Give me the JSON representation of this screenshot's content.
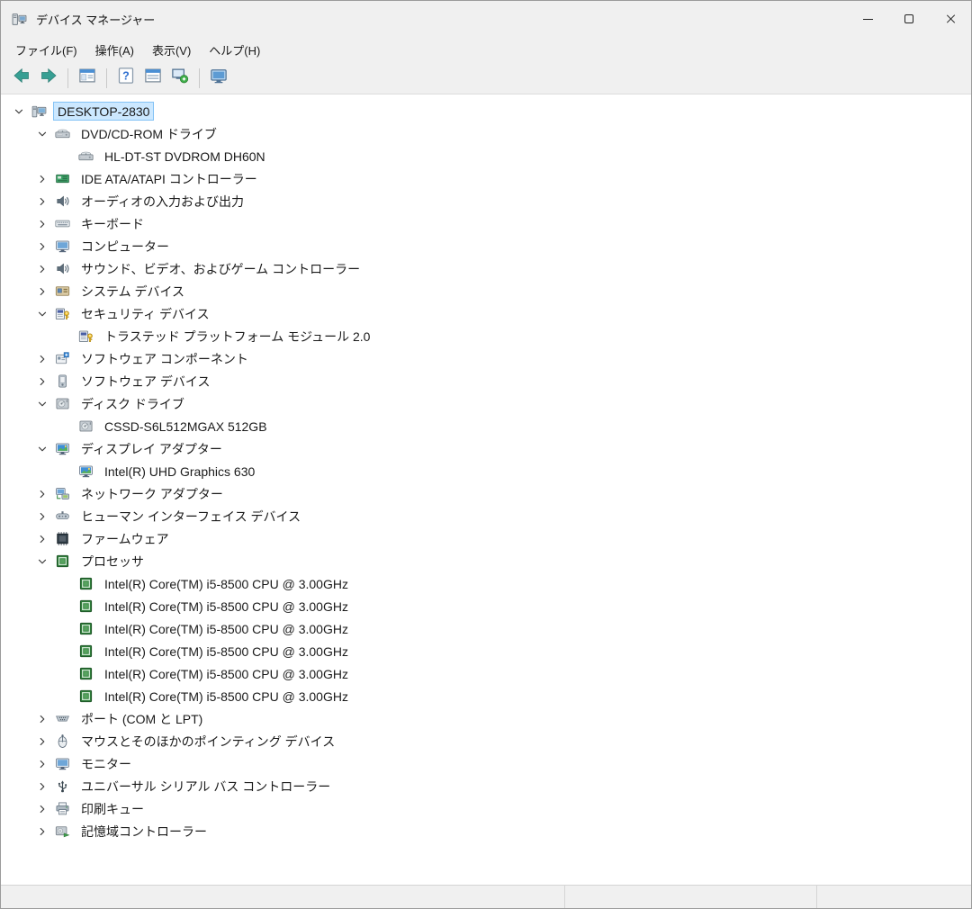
{
  "window": {
    "title": "デバイス マネージャー"
  },
  "menu": {
    "items": [
      {
        "id": "file",
        "label": "ファイル(F)"
      },
      {
        "id": "action",
        "label": "操作(A)"
      },
      {
        "id": "view",
        "label": "表示(V)"
      },
      {
        "id": "help",
        "label": "ヘルプ(H)"
      }
    ]
  },
  "toolbar": {
    "groups": [
      [
        {
          "name": "back",
          "icon": "back-arrow"
        },
        {
          "name": "forward",
          "icon": "forward-arrow"
        }
      ],
      [
        {
          "name": "console-tree",
          "icon": "console-window"
        }
      ],
      [
        {
          "name": "help",
          "icon": "help"
        },
        {
          "name": "properties",
          "icon": "properties-window"
        },
        {
          "name": "scan-hardware",
          "icon": "scan"
        }
      ],
      [
        {
          "name": "remote-desktop",
          "icon": "remote-monitor"
        }
      ]
    ]
  },
  "tree": {
    "items": [
      {
        "label": "DESKTOP-2830",
        "level": 0,
        "state": "expanded",
        "icon": "computer",
        "selected": true
      },
      {
        "label": "DVD/CD-ROM ドライブ",
        "level": 1,
        "state": "expanded",
        "icon": "cd-drive"
      },
      {
        "label": "HL-DT-ST DVDROM DH60N",
        "level": 2,
        "state": "leaf",
        "icon": "cd-drive"
      },
      {
        "label": "IDE ATA/ATAPI コントローラー",
        "level": 1,
        "state": "collapsed",
        "icon": "ide-controller"
      },
      {
        "label": "オーディオの入力および出力",
        "level": 1,
        "state": "collapsed",
        "icon": "audio-io"
      },
      {
        "label": "キーボード",
        "level": 1,
        "state": "collapsed",
        "icon": "keyboard"
      },
      {
        "label": "コンピューター",
        "level": 1,
        "state": "collapsed",
        "icon": "computer-monitor"
      },
      {
        "label": "サウンド、ビデオ、およびゲーム コントローラー",
        "level": 1,
        "state": "collapsed",
        "icon": "sound"
      },
      {
        "label": "システム デバイス",
        "level": 1,
        "state": "collapsed",
        "icon": "system-device"
      },
      {
        "label": "セキュリティ デバイス",
        "level": 1,
        "state": "expanded",
        "icon": "security"
      },
      {
        "label": "トラステッド プラットフォーム モジュール 2.0",
        "level": 2,
        "state": "leaf",
        "icon": "security"
      },
      {
        "label": "ソフトウェア コンポーネント",
        "level": 1,
        "state": "collapsed",
        "icon": "software-component"
      },
      {
        "label": "ソフトウェア デバイス",
        "level": 1,
        "state": "collapsed",
        "icon": "software-device"
      },
      {
        "label": "ディスク ドライブ",
        "level": 1,
        "state": "expanded",
        "icon": "disk-drive"
      },
      {
        "label": "CSSD-S6L512MGAX 512GB",
        "level": 2,
        "state": "leaf",
        "icon": "disk-drive"
      },
      {
        "label": "ディスプレイ アダプター",
        "level": 1,
        "state": "expanded",
        "icon": "display-adapter"
      },
      {
        "label": "Intel(R) UHD Graphics 630",
        "level": 2,
        "state": "leaf",
        "icon": "display-adapter"
      },
      {
        "label": "ネットワーク アダプター",
        "level": 1,
        "state": "collapsed",
        "icon": "network-adapter"
      },
      {
        "label": "ヒューマン インターフェイス デバイス",
        "level": 1,
        "state": "collapsed",
        "icon": "hid"
      },
      {
        "label": "ファームウェア",
        "level": 1,
        "state": "collapsed",
        "icon": "firmware"
      },
      {
        "label": "プロセッサ",
        "level": 1,
        "state": "expanded",
        "icon": "processor"
      },
      {
        "label": "Intel(R) Core(TM) i5-8500 CPU @ 3.00GHz",
        "level": 2,
        "state": "leaf",
        "icon": "processor"
      },
      {
        "label": "Intel(R) Core(TM) i5-8500 CPU @ 3.00GHz",
        "level": 2,
        "state": "leaf",
        "icon": "processor"
      },
      {
        "label": "Intel(R) Core(TM) i5-8500 CPU @ 3.00GHz",
        "level": 2,
        "state": "leaf",
        "icon": "processor"
      },
      {
        "label": "Intel(R) Core(TM) i5-8500 CPU @ 3.00GHz",
        "level": 2,
        "state": "leaf",
        "icon": "processor"
      },
      {
        "label": "Intel(R) Core(TM) i5-8500 CPU @ 3.00GHz",
        "level": 2,
        "state": "leaf",
        "icon": "processor"
      },
      {
        "label": "Intel(R) Core(TM) i5-8500 CPU @ 3.00GHz",
        "level": 2,
        "state": "leaf",
        "icon": "processor"
      },
      {
        "label": "ポート (COM と LPT)",
        "level": 1,
        "state": "collapsed",
        "icon": "ports"
      },
      {
        "label": "マウスとそのほかのポインティング デバイス",
        "level": 1,
        "state": "collapsed",
        "icon": "mouse"
      },
      {
        "label": "モニター",
        "level": 1,
        "state": "collapsed",
        "icon": "monitor"
      },
      {
        "label": "ユニバーサル シリアル バス コントローラー",
        "level": 1,
        "state": "collapsed",
        "icon": "usb"
      },
      {
        "label": "印刷キュー",
        "level": 1,
        "state": "collapsed",
        "icon": "print-queue"
      },
      {
        "label": "記憶域コントローラー",
        "level": 1,
        "state": "collapsed",
        "icon": "storage-controller"
      }
    ]
  },
  "colors": {
    "chrome_bg": "#f0f0f0",
    "selection_bg": "#cce8ff",
    "selection_border": "#84c3f5",
    "processor_green": "#2f7d3a"
  }
}
